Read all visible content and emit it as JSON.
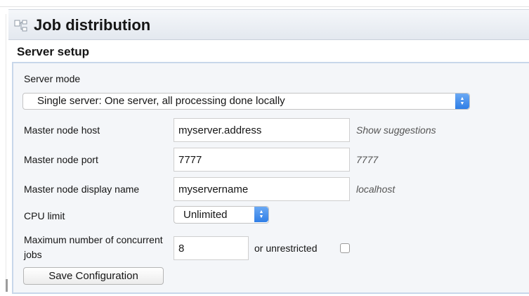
{
  "header": {
    "icon": "hierarchy-icon",
    "title": "Job distribution"
  },
  "section": {
    "title": "Server setup"
  },
  "server_mode": {
    "label": "Server mode",
    "selected": "Single server: One server, all processing done locally"
  },
  "fields": {
    "host": {
      "label": "Master node host",
      "value": "myserver.address",
      "hint": "Show suggestions"
    },
    "port": {
      "label": "Master node port",
      "value": "7777",
      "hint": "7777"
    },
    "display_name": {
      "label": "Master node display name",
      "value": "myservername",
      "hint": "localhost"
    }
  },
  "cpu": {
    "label": "CPU limit",
    "selected": "Unlimited"
  },
  "jobs": {
    "label": "Maximum number of concurrent jobs",
    "value": "8",
    "unrestricted_label": "or unrestricted",
    "unrestricted_checked": false
  },
  "actions": {
    "save_label": "Save Configuration"
  },
  "colors": {
    "accent": "#2f7ee6",
    "panel_bg": "#f4f6f9",
    "panel_border": "#c8d7ea"
  }
}
